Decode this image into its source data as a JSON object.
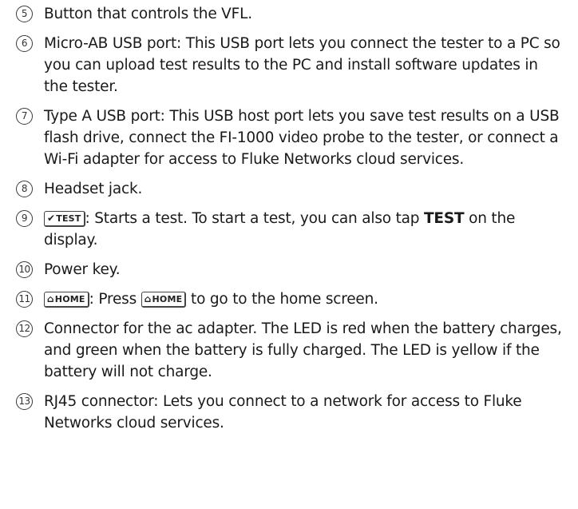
{
  "items": [
    {
      "num": "5",
      "text": "Button that controls the VFL."
    },
    {
      "num": "6",
      "text": "Micro-AB USB port: This USB port lets you connect the tester to a PC so you can upload test results to the PC and install software updates in the tester."
    },
    {
      "num": "7",
      "text": "Type A USB port: This USB host port lets you save test results on a USB flash drive, connect the FI-1000 video probe to the tester, or connect a Wi-Fi adapter for access to Fluke Networks cloud services."
    },
    {
      "num": "8",
      "text": "Headset jack."
    },
    {
      "num": "9",
      "key_icon": "checkmark-icon",
      "key_label": "TEST",
      "text_a": ": Starts a test. To start a test, you can also tap ",
      "bold": "TEST",
      "text_b": " on the display."
    },
    {
      "num": "10",
      "text": "Power key."
    },
    {
      "num": "11",
      "key_icon": "home-icon",
      "key_label": "HOME",
      "text_a": ": Press ",
      "text_b": " to go to the home screen."
    },
    {
      "num": "12",
      "text": "Connector for the ac adapter. The LED is red when the battery charges, and green when the battery is fully charged. The LED is yellow if the battery will not charge."
    },
    {
      "num": "13",
      "text": "RJ45 connector: Lets you connect to a network for access to Fluke Networks cloud services."
    }
  ]
}
